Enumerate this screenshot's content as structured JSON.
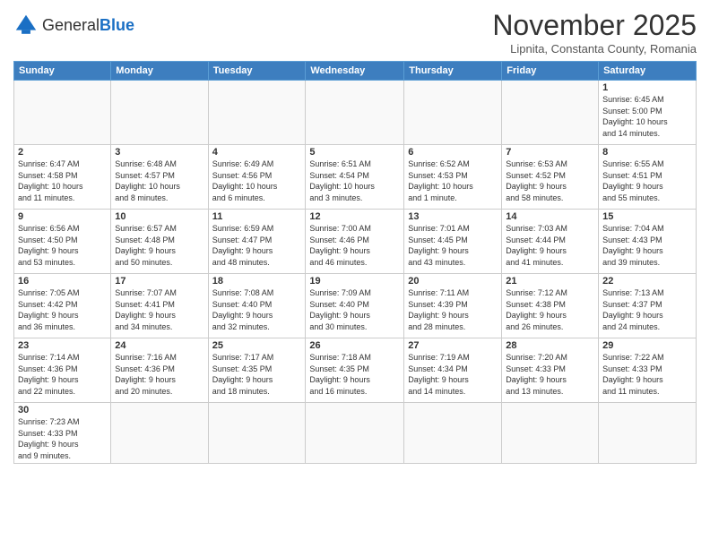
{
  "logo": {
    "text_general": "General",
    "text_blue": "Blue"
  },
  "header": {
    "month_title": "November 2025",
    "location": "Lipnita, Constanta County, Romania"
  },
  "weekdays": [
    "Sunday",
    "Monday",
    "Tuesday",
    "Wednesday",
    "Thursday",
    "Friday",
    "Saturday"
  ],
  "weeks": [
    [
      {
        "day": "",
        "info": ""
      },
      {
        "day": "",
        "info": ""
      },
      {
        "day": "",
        "info": ""
      },
      {
        "day": "",
        "info": ""
      },
      {
        "day": "",
        "info": ""
      },
      {
        "day": "",
        "info": ""
      },
      {
        "day": "1",
        "info": "Sunrise: 6:45 AM\nSunset: 5:00 PM\nDaylight: 10 hours\nand 14 minutes."
      }
    ],
    [
      {
        "day": "2",
        "info": "Sunrise: 6:47 AM\nSunset: 4:58 PM\nDaylight: 10 hours\nand 11 minutes."
      },
      {
        "day": "3",
        "info": "Sunrise: 6:48 AM\nSunset: 4:57 PM\nDaylight: 10 hours\nand 8 minutes."
      },
      {
        "day": "4",
        "info": "Sunrise: 6:49 AM\nSunset: 4:56 PM\nDaylight: 10 hours\nand 6 minutes."
      },
      {
        "day": "5",
        "info": "Sunrise: 6:51 AM\nSunset: 4:54 PM\nDaylight: 10 hours\nand 3 minutes."
      },
      {
        "day": "6",
        "info": "Sunrise: 6:52 AM\nSunset: 4:53 PM\nDaylight: 10 hours\nand 1 minute."
      },
      {
        "day": "7",
        "info": "Sunrise: 6:53 AM\nSunset: 4:52 PM\nDaylight: 9 hours\nand 58 minutes."
      },
      {
        "day": "8",
        "info": "Sunrise: 6:55 AM\nSunset: 4:51 PM\nDaylight: 9 hours\nand 55 minutes."
      }
    ],
    [
      {
        "day": "9",
        "info": "Sunrise: 6:56 AM\nSunset: 4:50 PM\nDaylight: 9 hours\nand 53 minutes."
      },
      {
        "day": "10",
        "info": "Sunrise: 6:57 AM\nSunset: 4:48 PM\nDaylight: 9 hours\nand 50 minutes."
      },
      {
        "day": "11",
        "info": "Sunrise: 6:59 AM\nSunset: 4:47 PM\nDaylight: 9 hours\nand 48 minutes."
      },
      {
        "day": "12",
        "info": "Sunrise: 7:00 AM\nSunset: 4:46 PM\nDaylight: 9 hours\nand 46 minutes."
      },
      {
        "day": "13",
        "info": "Sunrise: 7:01 AM\nSunset: 4:45 PM\nDaylight: 9 hours\nand 43 minutes."
      },
      {
        "day": "14",
        "info": "Sunrise: 7:03 AM\nSunset: 4:44 PM\nDaylight: 9 hours\nand 41 minutes."
      },
      {
        "day": "15",
        "info": "Sunrise: 7:04 AM\nSunset: 4:43 PM\nDaylight: 9 hours\nand 39 minutes."
      }
    ],
    [
      {
        "day": "16",
        "info": "Sunrise: 7:05 AM\nSunset: 4:42 PM\nDaylight: 9 hours\nand 36 minutes."
      },
      {
        "day": "17",
        "info": "Sunrise: 7:07 AM\nSunset: 4:41 PM\nDaylight: 9 hours\nand 34 minutes."
      },
      {
        "day": "18",
        "info": "Sunrise: 7:08 AM\nSunset: 4:40 PM\nDaylight: 9 hours\nand 32 minutes."
      },
      {
        "day": "19",
        "info": "Sunrise: 7:09 AM\nSunset: 4:40 PM\nDaylight: 9 hours\nand 30 minutes."
      },
      {
        "day": "20",
        "info": "Sunrise: 7:11 AM\nSunset: 4:39 PM\nDaylight: 9 hours\nand 28 minutes."
      },
      {
        "day": "21",
        "info": "Sunrise: 7:12 AM\nSunset: 4:38 PM\nDaylight: 9 hours\nand 26 minutes."
      },
      {
        "day": "22",
        "info": "Sunrise: 7:13 AM\nSunset: 4:37 PM\nDaylight: 9 hours\nand 24 minutes."
      }
    ],
    [
      {
        "day": "23",
        "info": "Sunrise: 7:14 AM\nSunset: 4:36 PM\nDaylight: 9 hours\nand 22 minutes."
      },
      {
        "day": "24",
        "info": "Sunrise: 7:16 AM\nSunset: 4:36 PM\nDaylight: 9 hours\nand 20 minutes."
      },
      {
        "day": "25",
        "info": "Sunrise: 7:17 AM\nSunset: 4:35 PM\nDaylight: 9 hours\nand 18 minutes."
      },
      {
        "day": "26",
        "info": "Sunrise: 7:18 AM\nSunset: 4:35 PM\nDaylight: 9 hours\nand 16 minutes."
      },
      {
        "day": "27",
        "info": "Sunrise: 7:19 AM\nSunset: 4:34 PM\nDaylight: 9 hours\nand 14 minutes."
      },
      {
        "day": "28",
        "info": "Sunrise: 7:20 AM\nSunset: 4:33 PM\nDaylight: 9 hours\nand 13 minutes."
      },
      {
        "day": "29",
        "info": "Sunrise: 7:22 AM\nSunset: 4:33 PM\nDaylight: 9 hours\nand 11 minutes."
      }
    ],
    [
      {
        "day": "30",
        "info": "Sunrise: 7:23 AM\nSunset: 4:33 PM\nDaylight: 9 hours\nand 9 minutes."
      },
      {
        "day": "",
        "info": ""
      },
      {
        "day": "",
        "info": ""
      },
      {
        "day": "",
        "info": ""
      },
      {
        "day": "",
        "info": ""
      },
      {
        "day": "",
        "info": ""
      },
      {
        "day": "",
        "info": ""
      }
    ]
  ]
}
